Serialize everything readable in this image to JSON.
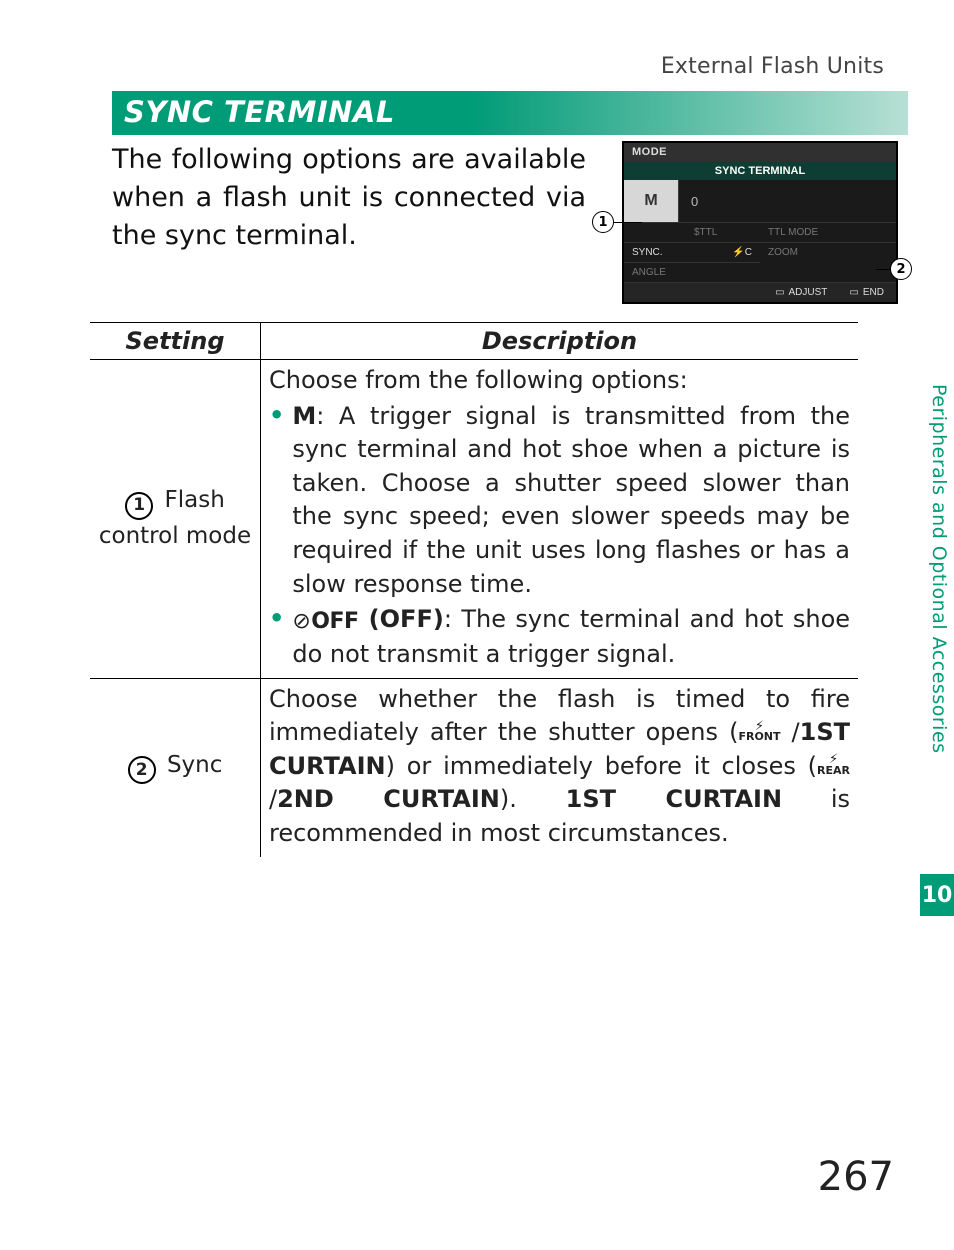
{
  "breadcrumb": "External Flash Units",
  "heading": "SYNC TERMINAL",
  "intro": "The following options are available when a flash unit is connected via the sync terminal.",
  "side_tab": {
    "label": "Peripherals and Optional Accessories",
    "chapter": "10"
  },
  "lcd": {
    "top": "MODE",
    "title": "SYNC TERMINAL",
    "mode_letter": "M",
    "mode_value": "0",
    "grid": {
      "tl": "TTL MODE",
      "tl2": "$TTL",
      "tr": "SYNC.",
      "bl": "ZOOM",
      "br": "ANGLE"
    },
    "sync_icon": "⚡C",
    "foot_adjust": "ADJUST",
    "foot_end": "END"
  },
  "callouts": {
    "c1": "1",
    "c2": "2"
  },
  "table": {
    "head_setting": "Setting",
    "head_desc": "Description",
    "rows": [
      {
        "num": "1",
        "label": "Flash control mode",
        "lead": "Choose from the following options:",
        "bullets": [
          {
            "lead_bold": "M",
            "text": ": A trigger signal is transmitted from the sync terminal and hot shoe when a picture is taken. Choose a shutter speed slower than the sync speed; even slower speeds may be required if the unit uses long flashes or has a slow response time."
          },
          {
            "off_icon": "OFF",
            "off_label": " (OFF)",
            "text": ": The sync terminal and hot shoe do not transmit a trigger signal."
          }
        ]
      },
      {
        "num": "2",
        "label": "Sync",
        "sync_pre": "Choose whether the flash is timed to fire immediately after the shutter opens (",
        "sync_front_sub": "FRONT",
        "sync_front_label": "1ST CURTAIN",
        "sync_mid1": ") or immediately before it closes (",
        "sync_rear_sub": "REAR",
        "sync_rear_label": "2ND CURTAIN",
        "sync_mid2": "). ",
        "sync_recommend": "1ST CURTAIN",
        "sync_post": " is recommended in most circumstances."
      }
    ]
  },
  "page_number": "267"
}
